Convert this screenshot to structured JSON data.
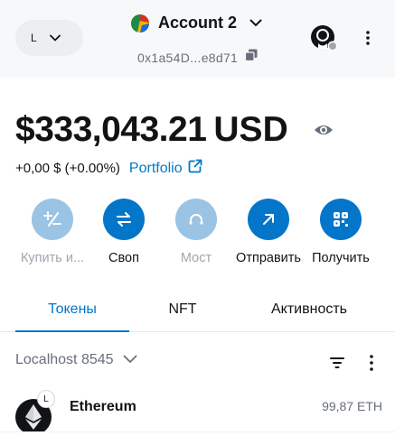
{
  "header": {
    "network_letter": "L",
    "account_name": "Account 2",
    "address": "0x1a54D...e8d71",
    "icons": {
      "network_chevron": "chevron-down-icon",
      "account_chevron": "chevron-down-icon",
      "copy": "copy-icon",
      "connected": "site-connection-icon",
      "menu": "more-vertical-icon"
    }
  },
  "balance": {
    "value": "$333,043.21",
    "currency": "USD",
    "change": "+0,00 $ (+0.00%)",
    "portfolio_label": "Portfolio",
    "icons": {
      "visibility": "eye-icon",
      "external": "external-link-icon"
    }
  },
  "actions": [
    {
      "label": "Купить и...",
      "icon": "buy-sell-icon",
      "enabled": false
    },
    {
      "label": "Своп",
      "icon": "swap-icon",
      "enabled": true
    },
    {
      "label": "Мост",
      "icon": "bridge-icon",
      "enabled": false
    },
    {
      "label": "Отправить",
      "icon": "send-arrow-icon",
      "enabled": true
    },
    {
      "label": "Получить",
      "icon": "receive-qr-icon",
      "enabled": true
    }
  ],
  "tabs": [
    {
      "label": "Токены",
      "active": true
    },
    {
      "label": "NFT",
      "active": false
    },
    {
      "label": "Активность",
      "active": false
    }
  ],
  "list": {
    "network_filter": "Localhost 8545",
    "icons": {
      "sort": "filter-icon",
      "menu": "more-vertical-icon"
    },
    "tokens": [
      {
        "name": "Ethereum",
        "amount": "99,87 ETH",
        "badge": "L",
        "icon": "ethereum-icon"
      }
    ]
  },
  "colors": {
    "accent": "#0376c9",
    "accent_disabled": "#9ac3e4",
    "text_primary": "#121314",
    "text_muted": "#686e7d",
    "header_bg": "#f7f8f9"
  }
}
